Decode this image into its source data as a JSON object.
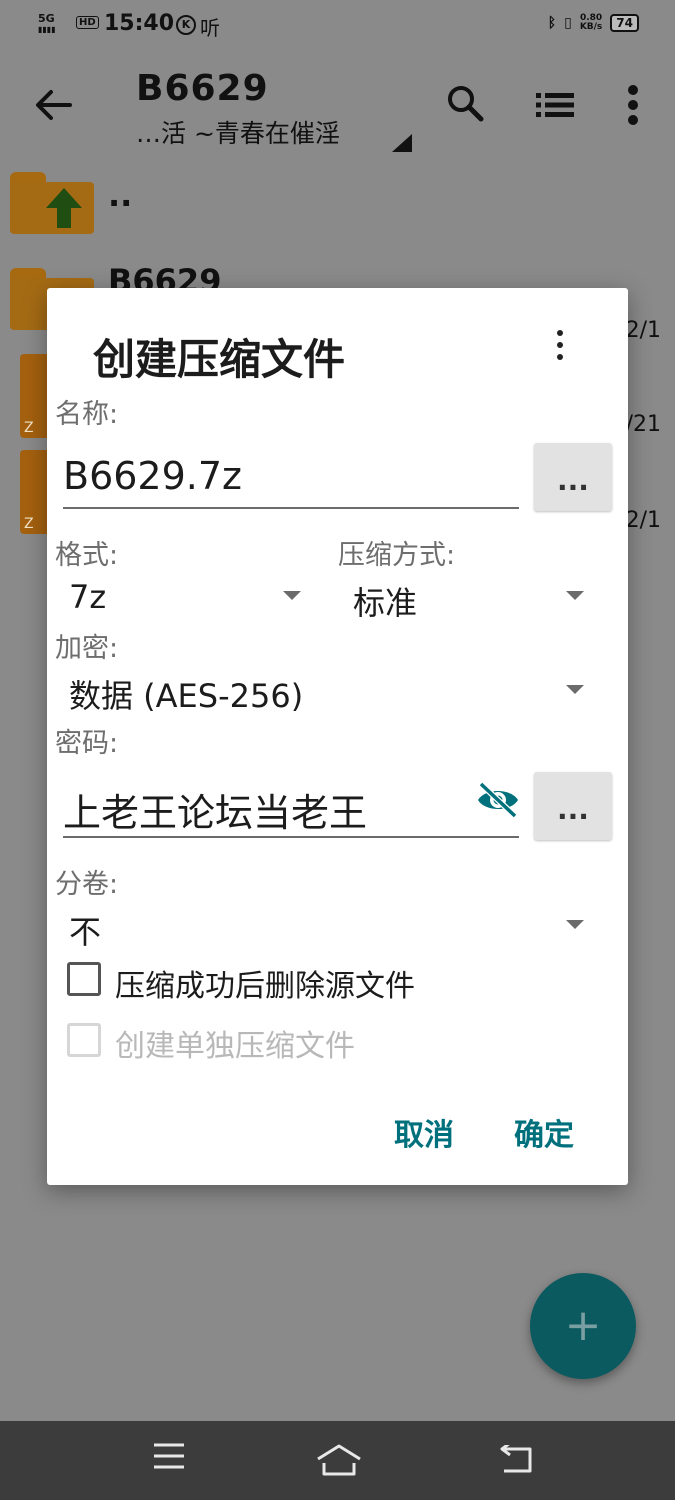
{
  "status_bar": {
    "signal": "5G",
    "hd": "HD",
    "time": "15:40",
    "k_badge": "K",
    "listen": "听",
    "net_speed": "0.80",
    "net_unit": "KB/s",
    "battery": "74"
  },
  "app_bar": {
    "title": "B6629",
    "subtitle": "…活 ~青春在催淫"
  },
  "file_list": {
    "parent_dir": "..",
    "folder_name": "B6629",
    "date_1": "2/1",
    "date_2": "/21",
    "date_3": "2/1",
    "zip_letter": "Z"
  },
  "dialog": {
    "title": "创建压缩文件",
    "name_label": "名称:",
    "name_value": "B6629.7z",
    "browse_button": "...",
    "format_label": "格式:",
    "format_value": "7z",
    "method_label": "压缩方式:",
    "method_value": "标准",
    "encryption_label": "加密:",
    "encryption_value": "数据 (AES-256)",
    "password_label": "密码:",
    "password_value": "上老王论坛当老王",
    "password_more_button": "...",
    "split_label": "分卷:",
    "split_value": "不",
    "delete_source_label": "压缩成功后删除源文件",
    "delete_source_checked": false,
    "separate_archives_label": "创建单独压缩文件",
    "separate_archives_checked": false,
    "separate_archives_enabled": false,
    "cancel_button": "取消",
    "ok_button": "确定"
  },
  "fab": {
    "icon": "plus-icon",
    "label": "+"
  },
  "colors": {
    "accent": "#00707c",
    "fab": "#0a5a60",
    "folder": "#a56b14",
    "scrim_bg": "#8a8a8a"
  }
}
